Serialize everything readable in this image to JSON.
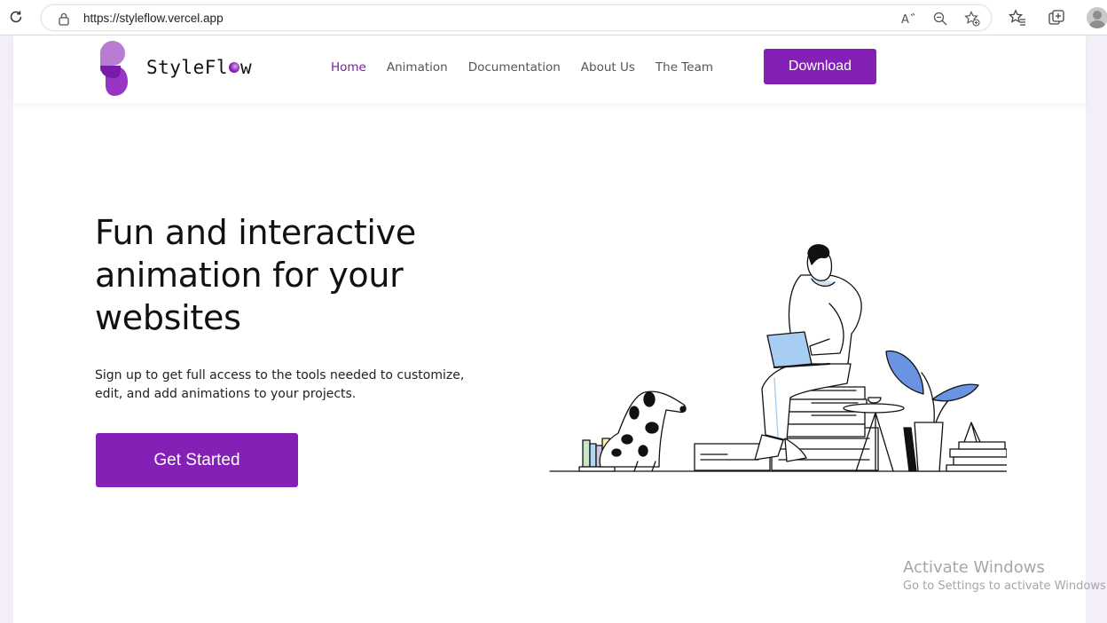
{
  "browser": {
    "url": "https://styleflow.vercel.app"
  },
  "site": {
    "logo_text_start": "StyleFl",
    "logo_text_end": "w",
    "nav": {
      "home": "Home",
      "animation": "Animation",
      "documentation": "Documentation",
      "about": "About Us",
      "team": "The Team"
    },
    "download_label": "Download",
    "accent_color": "#8420b5"
  },
  "hero": {
    "title": "Fun and interactive animation for your websites",
    "subtitle": "Sign up to get full access to the tools needed to customize, edit, and add animations to your projects.",
    "cta_label": "Get Started"
  },
  "watermark": {
    "line1": "Activate Windows",
    "line2": "Go to Settings to activate Windows."
  }
}
